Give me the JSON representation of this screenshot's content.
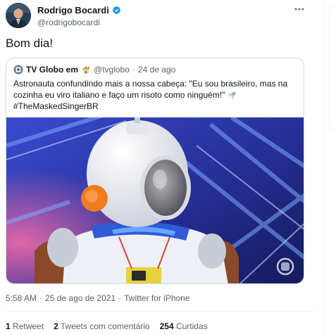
{
  "author": {
    "display_name": "Rodrigo Bocardi",
    "handle": "@rodrigobocardi",
    "avatar_icon": "person-avatar",
    "verified_icon": "verified-badge-icon",
    "more_icon": "more-options-icon"
  },
  "tweet": {
    "text": "Bom dia!"
  },
  "quote": {
    "name": "TV Globo em",
    "handle": "@tvglobo",
    "separator": "·",
    "date": "24 de ago",
    "logo_icon": "globo-logo-icon",
    "home_emoji": "house-emoji-icon",
    "text": "Astronauta confundindo mais a nossa cabeça: \"Eu sou brasileiro, mas na cozinha eu viro italiano e faço um risoto como ninguém!\"",
    "rocket_emoji": "rocket-emoji-icon",
    "hashtag": "#TheMaskedSingerBR",
    "media_description_icon": "astronaut-costume-image"
  },
  "meta": {
    "time": "5:58 AM",
    "dot1": "·",
    "date": "25 de ago de 2021",
    "dot2": "·",
    "source": "Twitter for iPhone"
  },
  "stats": {
    "retweets_count": "1",
    "retweets_label": "Retweet",
    "quotes_count": "2",
    "quotes_label": "Tweets com comentário",
    "likes_count": "254",
    "likes_label": "Curtidas"
  },
  "colors": {
    "text_primary": "#0f1419",
    "text_secondary": "#536471",
    "verified_blue": "#1d9bf0",
    "border": "#cfd9de"
  }
}
